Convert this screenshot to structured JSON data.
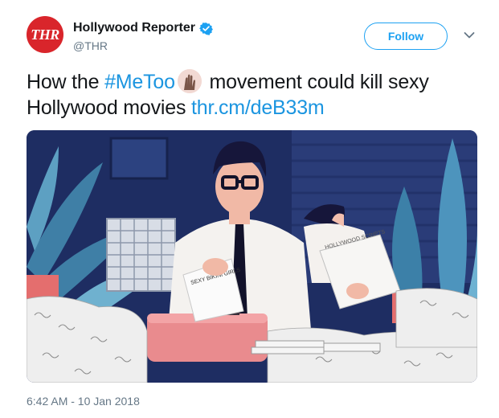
{
  "account": {
    "avatar_text": "THR",
    "name": "Hollywood Reporter",
    "handle": "@THR",
    "verified_icon": "verified-badge-icon"
  },
  "actions": {
    "follow_label": "Follow",
    "more_icon": "chevron-down-icon"
  },
  "tweet": {
    "text_before": "How the ",
    "hashtag": "#MeToo",
    "emoji_icon": "raised-hands-emoji",
    "text_middle": " movement could kill sexy Hollywood movies ",
    "link": "thr.cm/deB33m"
  },
  "media": {
    "paper_label": "SEXY BIKINI GIRLS",
    "folder_label": "HOLLYWOOD SCRIPTS"
  },
  "meta": {
    "timestamp": "6:42 AM - 10 Jan 2018"
  },
  "colors": {
    "accent": "#1da1f2",
    "avatar_bg": "#d9252b",
    "link": "#1b95e0",
    "muted": "#657786"
  }
}
